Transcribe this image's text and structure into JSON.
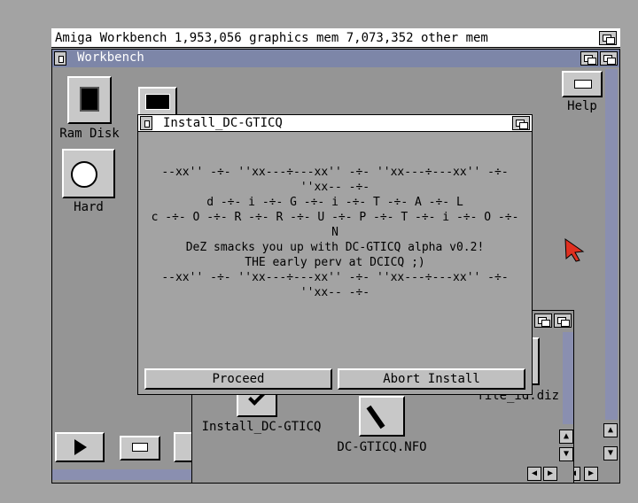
{
  "screen": {
    "title": "Amiga Workbench  1,953,056 graphics mem  7,073,352 other mem"
  },
  "workbench_window": {
    "title": "Workbench"
  },
  "icons": {
    "ram_disk": "Ram Disk",
    "hard": "Hard",
    "help": "Help",
    "install": "Install_DC-GTICQ",
    "nfo": "DC-GTICQ.NFO",
    "file_id": "file_id.diz"
  },
  "dialog": {
    "title": "Install_DC-GTICQ",
    "lines": [
      "--xx'' -÷- ''xx---÷---xx'' -÷- ''xx---÷---xx'' -÷-",
      "''xx-- -÷-",
      "",
      "d -÷- i -÷- G -÷- i -÷- T -÷- A -÷- L",
      "c -÷- O -÷- R -÷- R -÷- U -÷- P -÷- T -÷- i -÷- O -÷-",
      "N",
      "",
      "DeZ smacks you up with DC-GTICQ alpha v0.2!",
      "",
      "THE early perv at DCICQ ;)",
      "",
      "--xx'' -÷- ''xx---÷---xx'' -÷- ''xx---÷---xx'' -÷-",
      "''xx-- -÷-"
    ],
    "proceed_label": "Proceed",
    "abort_label": "Abort Install"
  },
  "colors": {
    "screen_bg": "#959595",
    "titlebar_active": "#7d86a8",
    "pointer": "#e03020"
  }
}
